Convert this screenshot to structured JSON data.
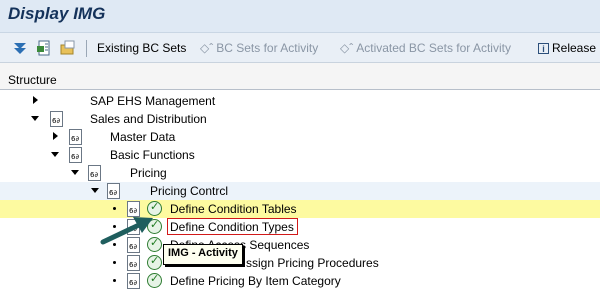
{
  "window": {
    "title": "Display IMG"
  },
  "toolbar": {
    "existing_bc_sets": "Existing BC Sets",
    "bc_sets_for_activity": "BC Sets for Activity",
    "activated_bc_sets": "Activated BC Sets for Activity",
    "release_notes": "Release"
  },
  "header": {
    "structure_label": "Structure"
  },
  "tree": {
    "sap_ehs": "SAP EHS Management",
    "sales_distribution": "Sales and Distribution",
    "master_data": "Master Data",
    "basic_functions": "Basic Functions",
    "pricing": "Pricing",
    "pricing_control": "Pricing Contrcl",
    "define_condition_tables": "Define Condition Tables",
    "define_condition_types": "Define Condition Types",
    "define_access_sequences": "Define Access Sequences",
    "assign_pricing_procedures": "ssign Pricing Procedures",
    "define_pricing_by_item_category": "Define Pricing By Item Category"
  },
  "tooltip": {
    "text": "IMG - Activity"
  },
  "colors": {
    "titlebar": "#dfe9f4",
    "highlight_row": "#fdfaa0",
    "selection_border": "#d11919",
    "arrow": "#1f5e5e"
  },
  "icons": {
    "toolbar_1": "filter-icon",
    "toolbar_2": "export-icon",
    "toolbar_3": "folder-icon",
    "bc_sets": "bc-set-icon",
    "release": "info-icon",
    "tree_doc": "documentation-icon",
    "tree_exec": "execute-clock-icon"
  }
}
